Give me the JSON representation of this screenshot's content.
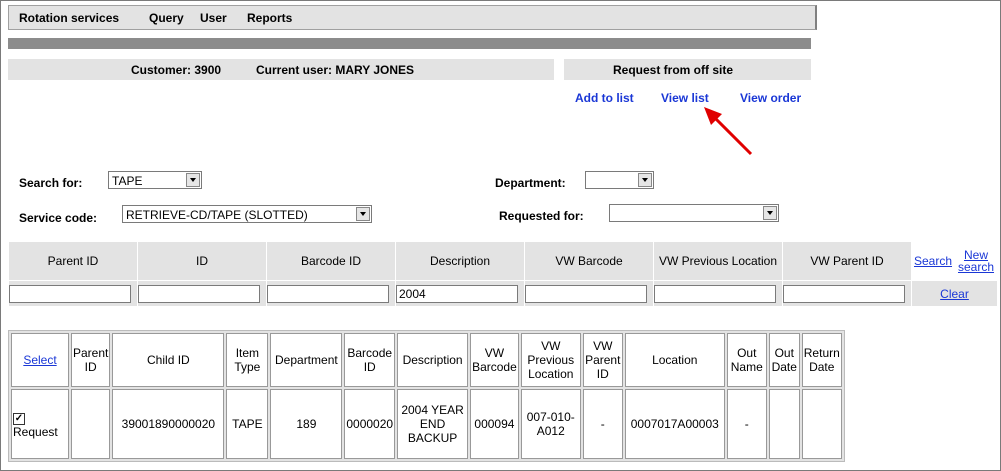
{
  "menu": [
    "Rotation services",
    "Query",
    "User",
    "Reports"
  ],
  "customer": {
    "customer": "Customer: 3900",
    "user": "Current user: MARY JONES",
    "request": "Request from off site"
  },
  "links": {
    "add": "Add to list",
    "view": "View list",
    "order": "View order"
  },
  "form": {
    "search_for_label": "Search for:",
    "search_for_value": "TAPE",
    "department_label": "Department:",
    "department_value": "",
    "service_code_label": "Service code:",
    "service_code_value": "RETRIEVE-CD/TAPE (SLOTTED)",
    "requested_for_label": "Requested for:",
    "requested_for_value": ""
  },
  "search_table": {
    "headers": [
      "Parent ID",
      "ID",
      "Barcode ID",
      "Description",
      "VW Barcode",
      "VW Previous Location",
      "VW Parent ID"
    ],
    "values": [
      "",
      "",
      "",
      "2004",
      "",
      "",
      ""
    ],
    "search_label": "Search",
    "new_search_label": "New search",
    "clear_label": "Clear"
  },
  "results": {
    "select_label": "Select",
    "headers": [
      "Parent ID",
      "Child ID",
      "Item Type",
      "Department",
      "Barcode ID",
      "Description",
      "VW Barcode",
      "VW Previous Location",
      "VW Parent ID",
      "Location",
      "Out Name",
      "Out Date",
      "Return Date"
    ],
    "rows": [
      {
        "select": "Request",
        "checked": true,
        "cells": [
          "",
          "39001890000020",
          "TAPE",
          "189",
          "0000020",
          "2004 YEAR END BACKUP",
          "000094",
          "007-010-A012",
          "-",
          "0007017A00003",
          "-",
          "",
          ""
        ]
      }
    ]
  },
  "colors": {
    "link": "#1a37d6",
    "bar": "#e3e3e3",
    "dark_bar": "#8c8c8c",
    "arrow": "#e00000"
  }
}
